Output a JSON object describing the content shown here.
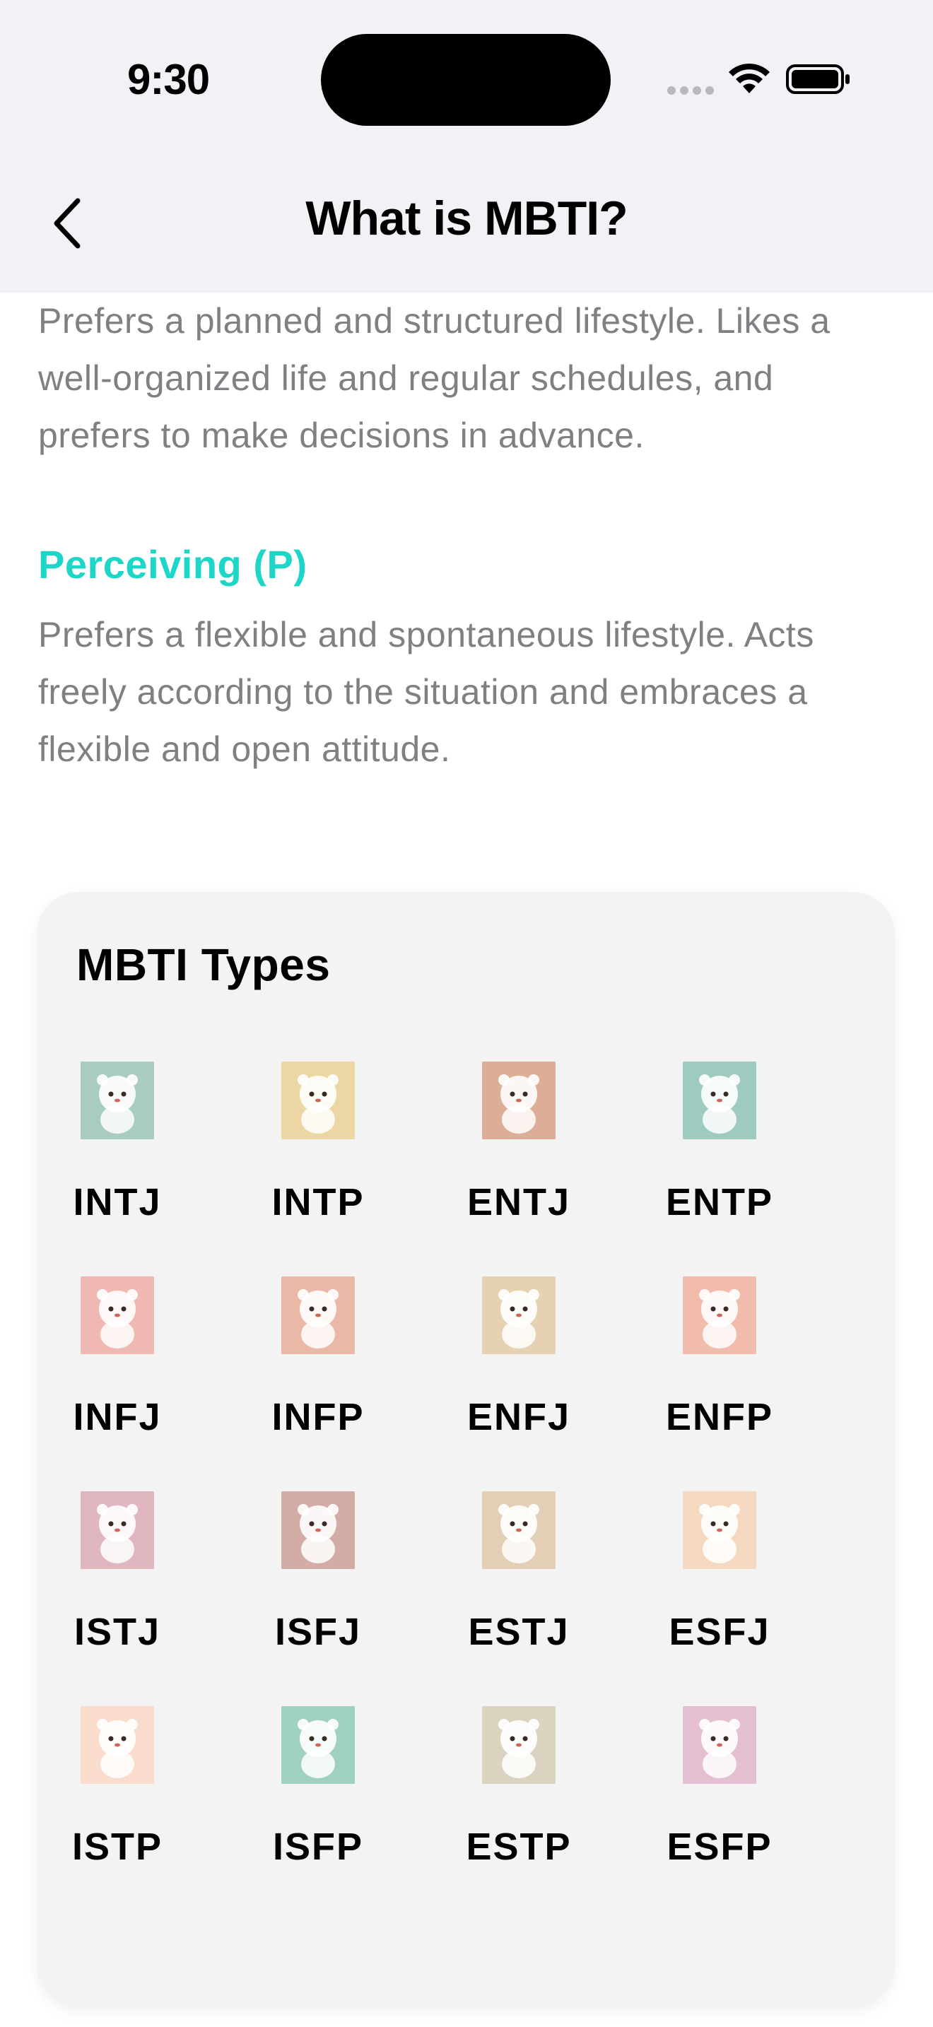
{
  "status_bar": {
    "time": "9:30"
  },
  "nav": {
    "title": "What is MBTI?"
  },
  "content": {
    "judging_desc": "Prefers a planned and structured lifestyle. Likes a well-organized life and regular schedules, and prefers to make decisions in advance.",
    "perceiving_title": "Perceiving (P)",
    "perceiving_desc": "Prefers a flexible and spontaneous lifestyle. Acts freely according to the situation and embraces a flexible and open attitude."
  },
  "types_card": {
    "title": "MBTI Types",
    "types": [
      {
        "label": "INTJ",
        "animal": "cat-icon",
        "bg": "#a8cbc2"
      },
      {
        "label": "INTP",
        "animal": "owl-icon",
        "bg": "#ecd6a3"
      },
      {
        "label": "ENTJ",
        "animal": "lion-icon",
        "bg": "#dcae97"
      },
      {
        "label": "ENTP",
        "animal": "fox-icon",
        "bg": "#9fcac0"
      },
      {
        "label": "INFJ",
        "animal": "seal-icon",
        "bg": "#f0b8b3"
      },
      {
        "label": "INFP",
        "animal": "deer-icon",
        "bg": "#eab8a6"
      },
      {
        "label": "ENFJ",
        "animal": "elephant-icon",
        "bg": "#e6d2b3"
      },
      {
        "label": "ENFP",
        "animal": "alpaca-icon",
        "bg": "#f2bcad"
      },
      {
        "label": "ISTJ",
        "animal": "penguin-icon",
        "bg": "#dfb6bd"
      },
      {
        "label": "ISFJ",
        "animal": "koala-icon",
        "bg": "#d3aca6"
      },
      {
        "label": "ESTJ",
        "animal": "corgi-icon",
        "bg": "#e2cfb6"
      },
      {
        "label": "ESFJ",
        "animal": "dog-icon",
        "bg": "#f4d9c0"
      },
      {
        "label": "ISTP",
        "animal": "otter-icon",
        "bg": "#f9dccb"
      },
      {
        "label": "ISFP",
        "animal": "red-panda-icon",
        "bg": "#9fd0c0"
      },
      {
        "label": "ESTP",
        "animal": "dolphin-icon",
        "bg": "#d9d3c0"
      },
      {
        "label": "ESFP",
        "animal": "parrot-icon",
        "bg": "#e4bed1"
      }
    ]
  }
}
